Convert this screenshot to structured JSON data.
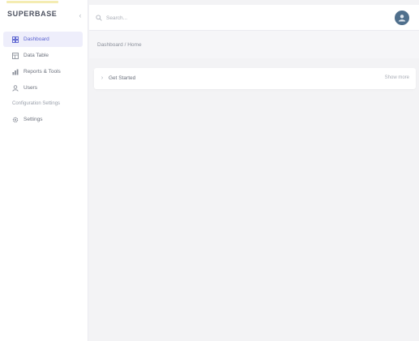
{
  "app": {
    "brand": "SUPERBASE",
    "collapse_glyph": "‹"
  },
  "colors": {
    "accent": "#5a62d0",
    "active_bg": "#eeeefb",
    "avatar": "#4f6f8c",
    "brand_bar": "#f4ecb2"
  },
  "sidebar": {
    "items": [
      {
        "label": "Dashboard",
        "icon": "grid-icon",
        "active": true
      },
      {
        "label": "Data Table",
        "icon": "table-icon",
        "active": false
      },
      {
        "label": "Reports & Tools",
        "icon": "chart-icon",
        "active": false
      },
      {
        "label": "Users",
        "icon": "user-icon",
        "active": false
      }
    ],
    "section_label": "Configuration Settings",
    "section_items": [
      {
        "label": "Settings",
        "icon": "gear-icon",
        "active": false
      }
    ]
  },
  "topbar": {
    "search_placeholder": "Search..."
  },
  "main": {
    "breadcrumb": "Dashboard / Home",
    "card": {
      "title": "Get Started",
      "meta": "Show more"
    }
  }
}
